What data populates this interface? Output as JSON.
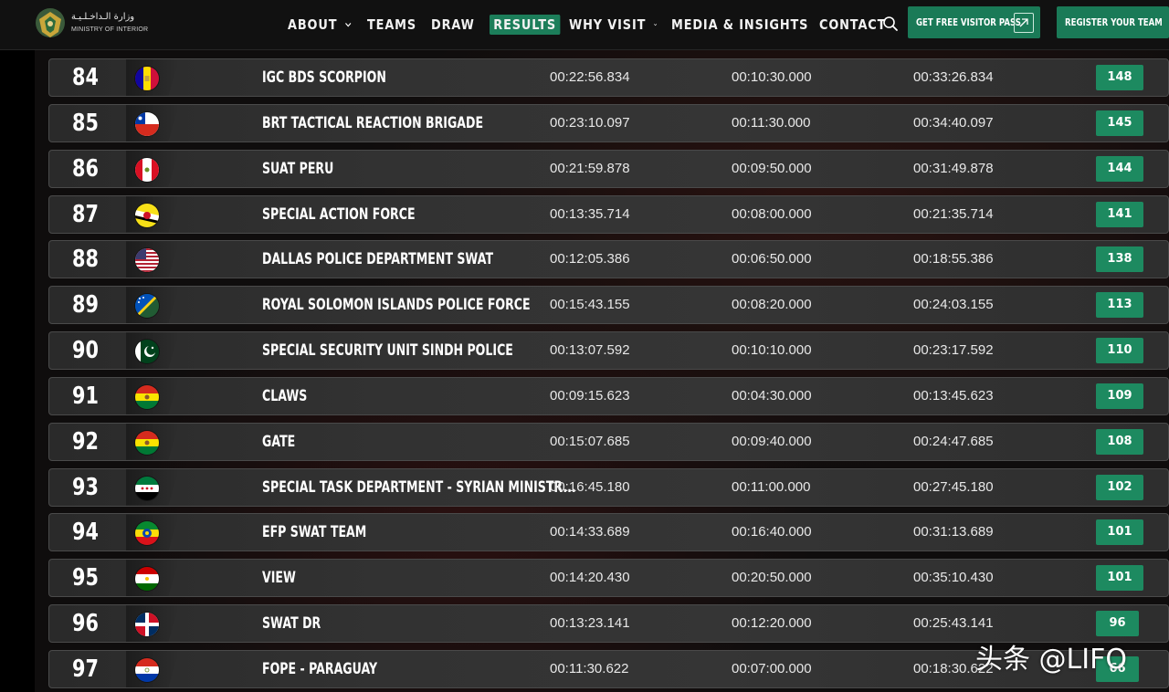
{
  "header": {
    "logo_arabic": "وزارة الـداخـلـيـة",
    "logo_english": "MINISTRY OF INTERIOR",
    "nav": [
      {
        "label": "ABOUT",
        "dropdown": true,
        "active": false
      },
      {
        "label": "TEAMS",
        "dropdown": false,
        "active": false
      },
      {
        "label": "DRAW",
        "dropdown": false,
        "active": false
      },
      {
        "label": "RESULTS",
        "dropdown": false,
        "active": true
      },
      {
        "label": "WHY VISIT",
        "dropdown": true,
        "active": false
      },
      {
        "label": "MEDIA & INSIGHTS",
        "dropdown": true,
        "active": false
      },
      {
        "label": "CONTACT",
        "dropdown": false,
        "active": false
      }
    ],
    "visitor_button": "GET FREE VISITOR PASS",
    "register_button": "REGISTER YOUR TEAM",
    "search_icon": "search-icon",
    "accent_color": "#1a7a57"
  },
  "results": [
    {
      "rank": "84",
      "flag": "andorra",
      "team": "IGC BDS SCORPION",
      "time1": "00:22:56.834",
      "time2": "00:10:30.000",
      "total": "00:33:26.834",
      "points": "148"
    },
    {
      "rank": "85",
      "flag": "chile",
      "team": "BRT TACTICAL REACTION BRIGADE",
      "time1": "00:23:10.097",
      "time2": "00:11:30.000",
      "total": "00:34:40.097",
      "points": "145"
    },
    {
      "rank": "86",
      "flag": "peru",
      "team": "SUAT PERU",
      "time1": "00:21:59.878",
      "time2": "00:09:50.000",
      "total": "00:31:49.878",
      "points": "144"
    },
    {
      "rank": "87",
      "flag": "brunei",
      "team": "SPECIAL ACTION FORCE",
      "time1": "00:13:35.714",
      "time2": "00:08:00.000",
      "total": "00:21:35.714",
      "points": "141"
    },
    {
      "rank": "88",
      "flag": "usa",
      "team": "DALLAS POLICE DEPARTMENT SWAT",
      "time1": "00:12:05.386",
      "time2": "00:06:50.000",
      "total": "00:18:55.386",
      "points": "138"
    },
    {
      "rank": "89",
      "flag": "solomon-islands",
      "team": "ROYAL SOLOMON ISLANDS POLICE FORCE",
      "time1": "00:15:43.155",
      "time2": "00:08:20.000",
      "total": "00:24:03.155",
      "points": "113"
    },
    {
      "rank": "90",
      "flag": "pakistan",
      "team": "SPECIAL SECURITY UNIT SINDH POLICE",
      "time1": "00:13:07.592",
      "time2": "00:10:10.000",
      "total": "00:23:17.592",
      "points": "110"
    },
    {
      "rank": "91",
      "flag": "bolivia",
      "team": "CLAWS",
      "time1": "00:09:15.623",
      "time2": "00:04:30.000",
      "total": "00:13:45.623",
      "points": "109"
    },
    {
      "rank": "92",
      "flag": "bolivia",
      "team": "GATE",
      "time1": "00:15:07.685",
      "time2": "00:09:40.000",
      "total": "00:24:47.685",
      "points": "108"
    },
    {
      "rank": "93",
      "flag": "syria",
      "team": "SPECIAL TASK DEPARTMENT - SYRIAN MINISTR...",
      "time1": "00:16:45.180",
      "time2": "00:11:00.000",
      "total": "00:27:45.180",
      "points": "102"
    },
    {
      "rank": "94",
      "flag": "ethiopia",
      "team": "EFP SWAT TEAM",
      "time1": "00:14:33.689",
      "time2": "00:16:40.000",
      "total": "00:31:13.689",
      "points": "101"
    },
    {
      "rank": "95",
      "flag": "tajikistan",
      "team": "VIEW",
      "time1": "00:14:20.430",
      "time2": "00:20:50.000",
      "total": "00:35:10.430",
      "points": "101"
    },
    {
      "rank": "96",
      "flag": "dominican-republic",
      "team": "SWAT DR",
      "time1": "00:13:23.141",
      "time2": "00:12:20.000",
      "total": "00:25:43.141",
      "points": "96"
    },
    {
      "rank": "97",
      "flag": "paraguay",
      "team": "FOPE - PARAGUAY",
      "time1": "00:11:30.622",
      "time2": "00:07:00.000",
      "total": "00:18:30.622",
      "points": "66"
    }
  ],
  "watermark": "头条 @LIFO"
}
